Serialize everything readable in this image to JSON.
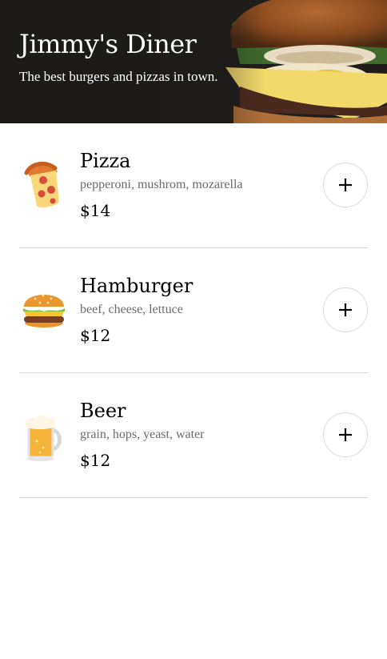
{
  "header": {
    "title": "Jimmy's Diner",
    "subtitle": "The best burgers and pizzas in town."
  },
  "menu": {
    "items": [
      {
        "name": "Pizza",
        "ingredients": "pepperoni, mushrom, mozarella",
        "price": "$14",
        "icon": "pizza-emoji-icon",
        "add_icon": "plus-icon"
      },
      {
        "name": "Hamburger",
        "ingredients": "beef, cheese, lettuce",
        "price": "$12",
        "icon": "hamburger-emoji-icon",
        "add_icon": "plus-icon"
      },
      {
        "name": "Beer",
        "ingredients": "grain, hops, yeast, water",
        "price": "$12",
        "icon": "beer-mug-emoji-icon",
        "add_icon": "plus-icon"
      }
    ]
  },
  "colors": {
    "header_background": "#1d1b1a",
    "divider": "#d6d6d6",
    "ingredients_text": "#6b6b6b",
    "button_border": "#dcdcdc"
  }
}
